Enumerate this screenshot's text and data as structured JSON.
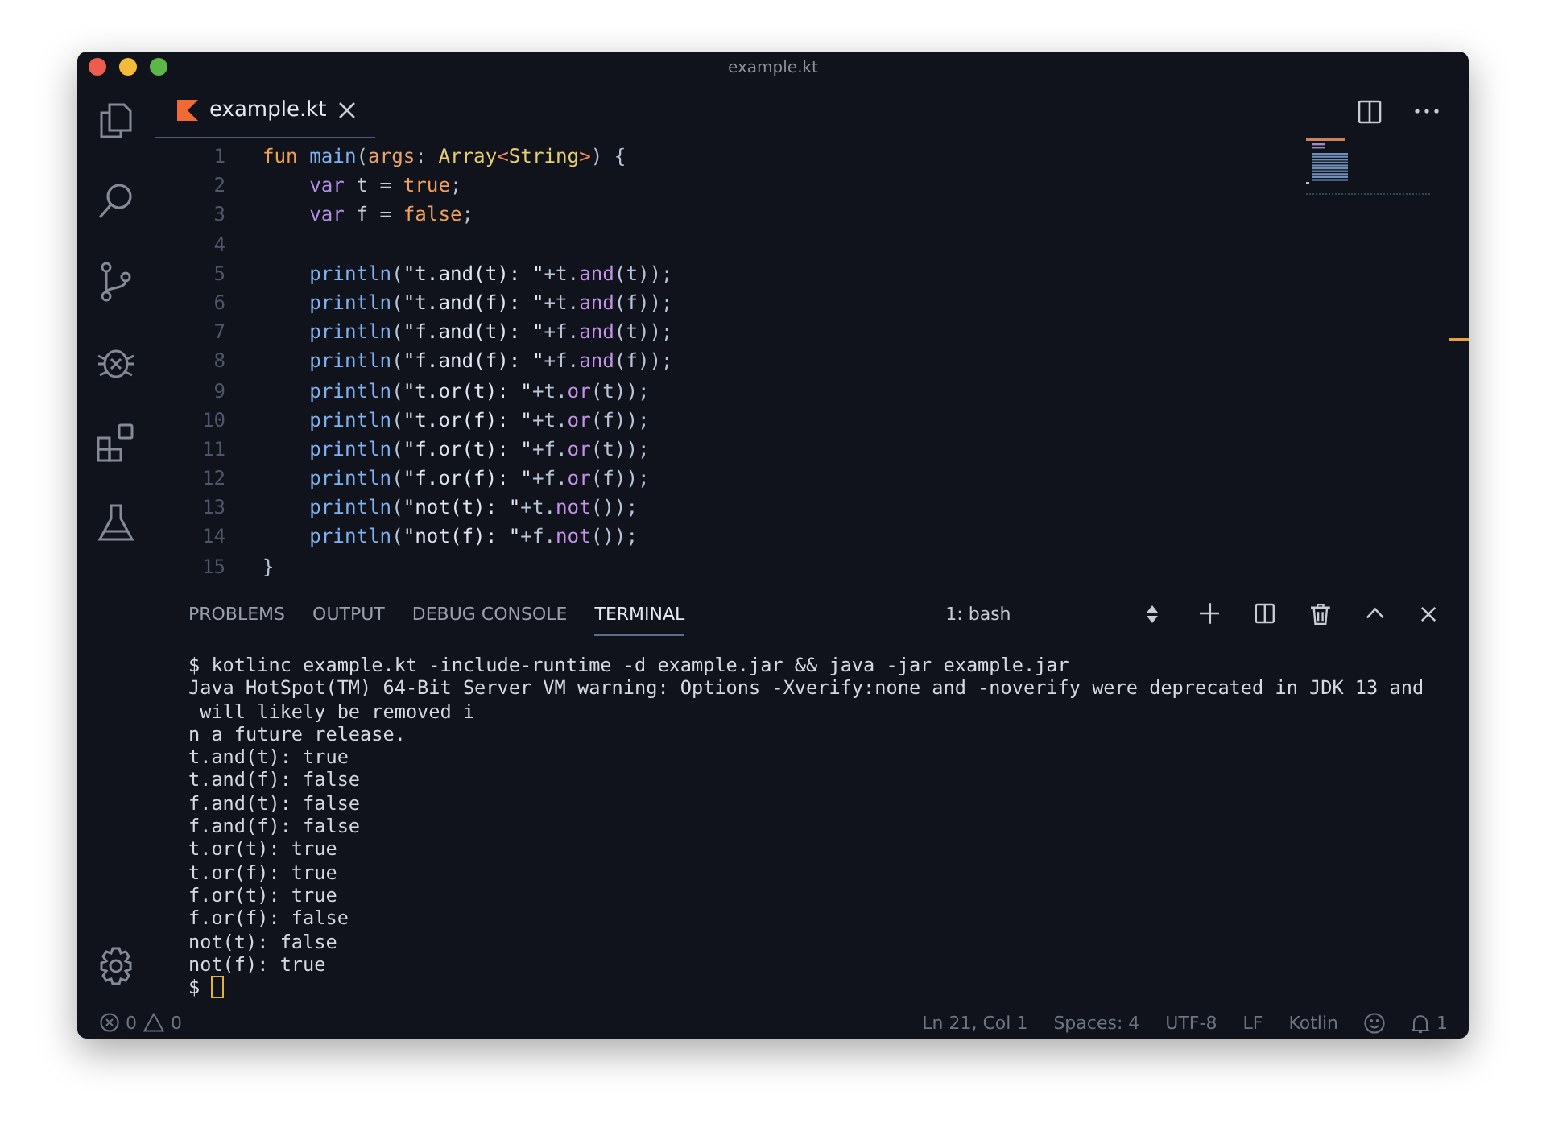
{
  "window": {
    "title": "example.kt"
  },
  "editor_tabs": [
    {
      "label": "example.kt",
      "selected": true
    }
  ],
  "code_lines": [
    {
      "number": "1",
      "indented": false,
      "tokens": [
        {
          "kind": "kw",
          "text": "fun"
        },
        {
          "kind": "fn",
          "text": " main"
        },
        {
          "kind": "punct",
          "text": "("
        },
        {
          "kind": "param",
          "text": "args"
        },
        {
          "kind": "punct",
          "text": ": "
        },
        {
          "kind": "type",
          "text": "Array"
        },
        {
          "kind": "op",
          "text": "<"
        },
        {
          "kind": "type",
          "text": "String"
        },
        {
          "kind": "op",
          "text": ">"
        },
        {
          "kind": "punct",
          "text": ") {"
        }
      ]
    },
    {
      "number": "2",
      "indented": true,
      "tokens": [
        {
          "kind": "decl",
          "text": "var"
        },
        {
          "kind": "plain",
          "text": " t = "
        },
        {
          "kind": "bool",
          "text": "true"
        },
        {
          "kind": "punct",
          "text": ";"
        }
      ]
    },
    {
      "number": "3",
      "indented": true,
      "tokens": [
        {
          "kind": "decl",
          "text": "var"
        },
        {
          "kind": "plain",
          "text": " f = "
        },
        {
          "kind": "bool",
          "text": "false"
        },
        {
          "kind": "punct",
          "text": ";"
        }
      ]
    },
    {
      "number": "4"
    },
    {
      "number": "5",
      "indented": true,
      "tokens": [
        {
          "kind": "fn",
          "text": "println"
        },
        {
          "kind": "punct",
          "text": "("
        },
        {
          "kind": "str",
          "text": "\"t.and(t): \""
        },
        {
          "kind": "punct",
          "text": "+t."
        },
        {
          "kind": "method",
          "text": "and"
        },
        {
          "kind": "punct",
          "text": "(t));"
        }
      ]
    },
    {
      "number": "6",
      "indented": true,
      "tokens": [
        {
          "kind": "fn",
          "text": "println"
        },
        {
          "kind": "punct",
          "text": "("
        },
        {
          "kind": "str",
          "text": "\"t.and(f): \""
        },
        {
          "kind": "punct",
          "text": "+t."
        },
        {
          "kind": "method",
          "text": "and"
        },
        {
          "kind": "punct",
          "text": "(f));"
        }
      ]
    },
    {
      "number": "7",
      "indented": true,
      "tokens": [
        {
          "kind": "fn",
          "text": "println"
        },
        {
          "kind": "punct",
          "text": "("
        },
        {
          "kind": "str",
          "text": "\"f.and(t): \""
        },
        {
          "kind": "punct",
          "text": "+f."
        },
        {
          "kind": "method",
          "text": "and"
        },
        {
          "kind": "punct",
          "text": "(t));"
        }
      ]
    },
    {
      "number": "8",
      "indented": true,
      "tokens": [
        {
          "kind": "fn",
          "text": "println"
        },
        {
          "kind": "punct",
          "text": "("
        },
        {
          "kind": "str",
          "text": "\"f.and(f): \""
        },
        {
          "kind": "punct",
          "text": "+f."
        },
        {
          "kind": "method",
          "text": "and"
        },
        {
          "kind": "punct",
          "text": "(f));"
        }
      ]
    },
    {
      "number": "9",
      "indented": true,
      "tokens": [
        {
          "kind": "fn",
          "text": "println"
        },
        {
          "kind": "punct",
          "text": "("
        },
        {
          "kind": "str",
          "text": "\"t.or(t): \""
        },
        {
          "kind": "punct",
          "text": "+t."
        },
        {
          "kind": "method",
          "text": "or"
        },
        {
          "kind": "punct",
          "text": "(t));"
        }
      ]
    },
    {
      "number": "10",
      "indented": true,
      "tokens": [
        {
          "kind": "fn",
          "text": "println"
        },
        {
          "kind": "punct",
          "text": "("
        },
        {
          "kind": "str",
          "text": "\"t.or(f): \""
        },
        {
          "kind": "punct",
          "text": "+t."
        },
        {
          "kind": "method",
          "text": "or"
        },
        {
          "kind": "punct",
          "text": "(f));"
        }
      ]
    },
    {
      "number": "11",
      "indented": true,
      "tokens": [
        {
          "kind": "fn",
          "text": "println"
        },
        {
          "kind": "punct",
          "text": "("
        },
        {
          "kind": "str",
          "text": "\"f.or(t): \""
        },
        {
          "kind": "punct",
          "text": "+f."
        },
        {
          "kind": "method",
          "text": "or"
        },
        {
          "kind": "punct",
          "text": "(t));"
        }
      ]
    },
    {
      "number": "12",
      "indented": true,
      "tokens": [
        {
          "kind": "fn",
          "text": "println"
        },
        {
          "kind": "punct",
          "text": "("
        },
        {
          "kind": "str",
          "text": "\"f.or(f): \""
        },
        {
          "kind": "punct",
          "text": "+f."
        },
        {
          "kind": "method",
          "text": "or"
        },
        {
          "kind": "punct",
          "text": "(f));"
        }
      ]
    },
    {
      "number": "13",
      "indented": true,
      "tokens": [
        {
          "kind": "fn",
          "text": "println"
        },
        {
          "kind": "punct",
          "text": "("
        },
        {
          "kind": "str",
          "text": "\"not(t): \""
        },
        {
          "kind": "punct",
          "text": "+t."
        },
        {
          "kind": "method",
          "text": "not"
        },
        {
          "kind": "punct",
          "text": "());"
        }
      ]
    },
    {
      "number": "14",
      "indented": true,
      "tokens": [
        {
          "kind": "fn",
          "text": "println"
        },
        {
          "kind": "punct",
          "text": "("
        },
        {
          "kind": "str",
          "text": "\"not(f): \""
        },
        {
          "kind": "punct",
          "text": "+f."
        },
        {
          "kind": "method",
          "text": "not"
        },
        {
          "kind": "punct",
          "text": "());"
        }
      ]
    },
    {
      "number": "15",
      "indented": false,
      "tokens": [
        {
          "kind": "punct",
          "text": "}"
        }
      ]
    }
  ],
  "panel_tabs": [
    {
      "label": "PROBLEMS",
      "selected": false
    },
    {
      "label": "OUTPUT",
      "selected": false
    },
    {
      "label": "DEBUG CONSOLE",
      "selected": false
    },
    {
      "label": "TERMINAL",
      "selected": true
    }
  ],
  "terminal_selector": "1: bash",
  "terminal_lines": [
    "$ kotlinc example.kt -include-runtime -d example.jar && java -jar example.jar",
    "Java HotSpot(TM) 64-Bit Server VM warning: Options -Xverify:none and -noverify were deprecated in JDK 13 and",
    " will likely be removed i",
    "n a future release.",
    "t.and(t): true",
    "t.and(f): false",
    "f.and(t): false",
    "f.and(f): false",
    "t.or(t): true",
    "t.or(f): true",
    "f.or(t): true",
    "f.or(f): false",
    "not(t): false",
    "not(f): true"
  ],
  "prompt": "$",
  "status_bar": {
    "errors": "0",
    "warnings": "0",
    "items": [
      "Ln 21, Col 1",
      "Spaces: 4",
      "UTF-8",
      "LF",
      "Kotlin"
    ],
    "notifications": "1"
  }
}
